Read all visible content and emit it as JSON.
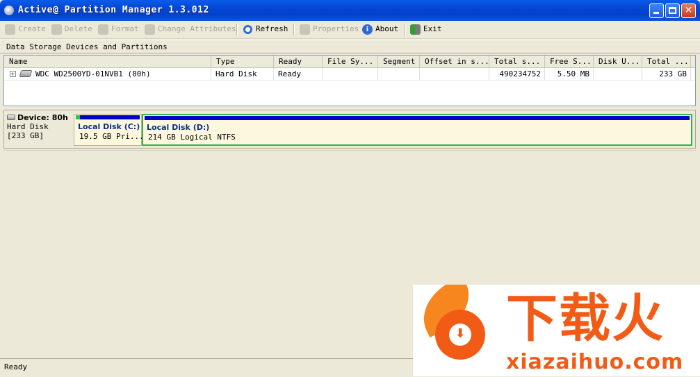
{
  "window": {
    "title": "Active@ Partition Manager 1.3.012"
  },
  "toolbar": {
    "create": "Create",
    "delete": "Delete",
    "format": "Format",
    "change_attributes": "Change Attributes",
    "refresh": "Refresh",
    "properties": "Properties",
    "about": "About",
    "exit": "Exit"
  },
  "section_label": "Data Storage Devices and Partitions",
  "grid": {
    "columns": [
      "Name",
      "Type",
      "Ready",
      "File Sy...",
      "Segment",
      "Offset in s...",
      "Total s...",
      "Free S...",
      "Disk U...",
      "Total ..."
    ],
    "rows": [
      {
        "name": "WDC WD2500YD-01NVB1 (80h)",
        "type": "Hard Disk",
        "ready": "Ready",
        "fs": "",
        "segment": "",
        "offset": "",
        "total_s": "490234752",
        "free": "5.50 MB",
        "disk_u": "",
        "total": "233 GB"
      }
    ]
  },
  "device": {
    "name": "Device: 80h",
    "type": "Hard Disk",
    "size": "[233 GB]",
    "partitions": [
      {
        "name": "Local Disk (C:) ...",
        "desc": "19.5 GB Pri...",
        "used_fraction": 0.06
      },
      {
        "name": "Local Disk (D:)",
        "desc": "214 GB Logical NTFS",
        "used_fraction": 0.0
      }
    ]
  },
  "status": {
    "text": "Ready"
  },
  "watermark": {
    "chinese": "下载火",
    "url": "xiazaihuo.com"
  },
  "colors": {
    "title_bar": "#0546d6",
    "partition_bar": "#0000c8",
    "used_green": "#2ec24a",
    "selection": "#34b24b",
    "watermark": "#f25b16"
  },
  "icons": [
    "app-icon",
    "minimize-icon",
    "maximize-icon",
    "close-icon",
    "create-icon",
    "delete-icon",
    "format-icon",
    "change-attributes-icon",
    "refresh-icon",
    "properties-icon",
    "about-icon",
    "exit-icon",
    "hard-disk-icon"
  ]
}
